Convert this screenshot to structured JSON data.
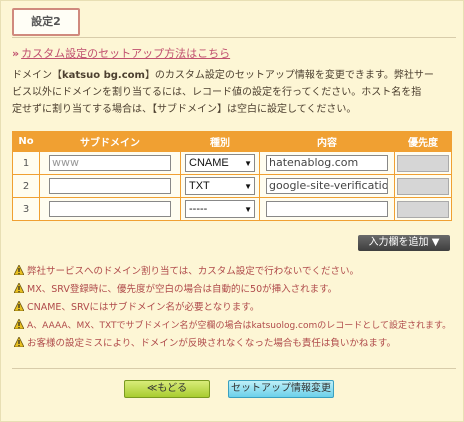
{
  "header": {
    "title": "設定2"
  },
  "help_link": {
    "marker": "»",
    "text": "カスタム設定のセットアップ方法はこちら"
  },
  "intro": {
    "line1_pre": "ドメイン【",
    "domain": "katsuo bg.com",
    "line1_post": "】のカスタム設定のセットアップ情報を変更できます。弊社サー",
    "line2": "ビス以外にドメインを割り当てるには、レコード値の設定を行ってください。ホスト名を指",
    "line3": "定せずに割り当てする場合は、【サブドメイン】は空白に設定してください。"
  },
  "table": {
    "headers": {
      "no": "No",
      "subdomain": "サブドメイン",
      "type": "種別",
      "content": "内容",
      "priority": "優先度"
    },
    "rows": [
      {
        "no": "1",
        "subdomain": "www",
        "type": "CNAME",
        "content": "hatenablog.com"
      },
      {
        "no": "2",
        "subdomain": "",
        "type": "TXT",
        "content": "google-site-verificatio"
      },
      {
        "no": "3",
        "subdomain": "",
        "type": "-----",
        "content": ""
      }
    ]
  },
  "add_button": {
    "label": "入力欄を追加 ▼"
  },
  "notes": [
    "弊社サービスへのドメイン割り当ては、カスタム設定で行わないでください。",
    "MX、SRV登録時に、優先度が空白の場合は自動的に50が挿入されます。",
    "CNAME、SRVにはサブドメイン名が必要となります。",
    "A、AAAA、MX、TXTでサブドメイン名が空欄の場合はkatsuolog.comのレコードとして設定されます。",
    "お客様の設定ミスにより、ドメインが反映されなくなった場合も責任は負いかねます。"
  ],
  "buttons": {
    "back": "≪もどる",
    "save": "セットアップ情報変更"
  },
  "colors": {
    "table_header": "#f0a032",
    "note_text": "#b04b4b",
    "link": "#c0506f",
    "background": "#fdf6d5"
  }
}
